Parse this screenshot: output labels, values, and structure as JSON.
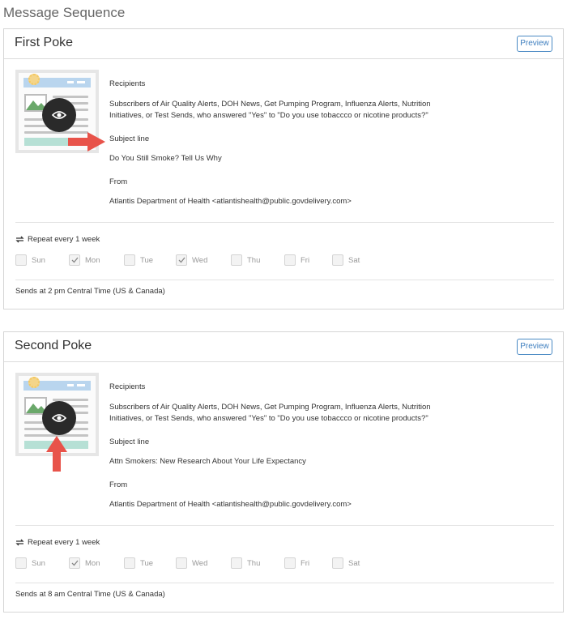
{
  "page": {
    "title": "Message Sequence"
  },
  "labels": {
    "preview": "Preview",
    "recipients": "Recipients",
    "subject_line": "Subject line",
    "from": "From"
  },
  "pokes": [
    {
      "title": "First Poke",
      "recipients_line1": "Subscribers of Air Quality Alerts, DOH News, Get Pumping Program, Influenza Alerts, Nutrition",
      "recipients_line2": "Initiatives, or Test Sends, who answered \"Yes\" to \"Do you use tobaccco or nicotine products?\"",
      "subject": "Do You Still Smoke? Tell Us Why",
      "from": "Atlantis Department of Health <atlantishealth@public.govdelivery.com>",
      "repeat": "Repeat every 1 week",
      "days": [
        {
          "label": "Sun",
          "checked": false
        },
        {
          "label": "Mon",
          "checked": true
        },
        {
          "label": "Tue",
          "checked": false
        },
        {
          "label": "Wed",
          "checked": true
        },
        {
          "label": "Thu",
          "checked": false
        },
        {
          "label": "Fri",
          "checked": false
        },
        {
          "label": "Sat",
          "checked": false
        }
      ],
      "sends": "Sends at 2 pm Central Time (US & Canada)"
    },
    {
      "title": "Second Poke",
      "recipients_line1": "Subscribers of Air Quality Alerts, DOH News, Get Pumping Program, Influenza Alerts, Nutrition",
      "recipients_line2": "Initiatives, or Test Sends, who answered \"Yes\" to \"Do you use tobaccco or nicotine products?\"",
      "subject": "Attn Smokers: New Research About Your Life Expectancy",
      "from": "Atlantis Department of Health <atlantishealth@public.govdelivery.com>",
      "repeat": "Repeat every 1 week",
      "days": [
        {
          "label": "Sun",
          "checked": false
        },
        {
          "label": "Mon",
          "checked": true
        },
        {
          "label": "Tue",
          "checked": false
        },
        {
          "label": "Wed",
          "checked": false
        },
        {
          "label": "Thu",
          "checked": false
        },
        {
          "label": "Fri",
          "checked": false
        },
        {
          "label": "Sat",
          "checked": false
        }
      ],
      "sends": "Sends at 8 am Central Time (US & Canada)"
    }
  ],
  "colors": {
    "accent": "#3f7fbf",
    "annotation_arrow": "#e8534a",
    "thumb_header": "#b9d5ee",
    "thumb_footer": "#b6e0d5"
  }
}
